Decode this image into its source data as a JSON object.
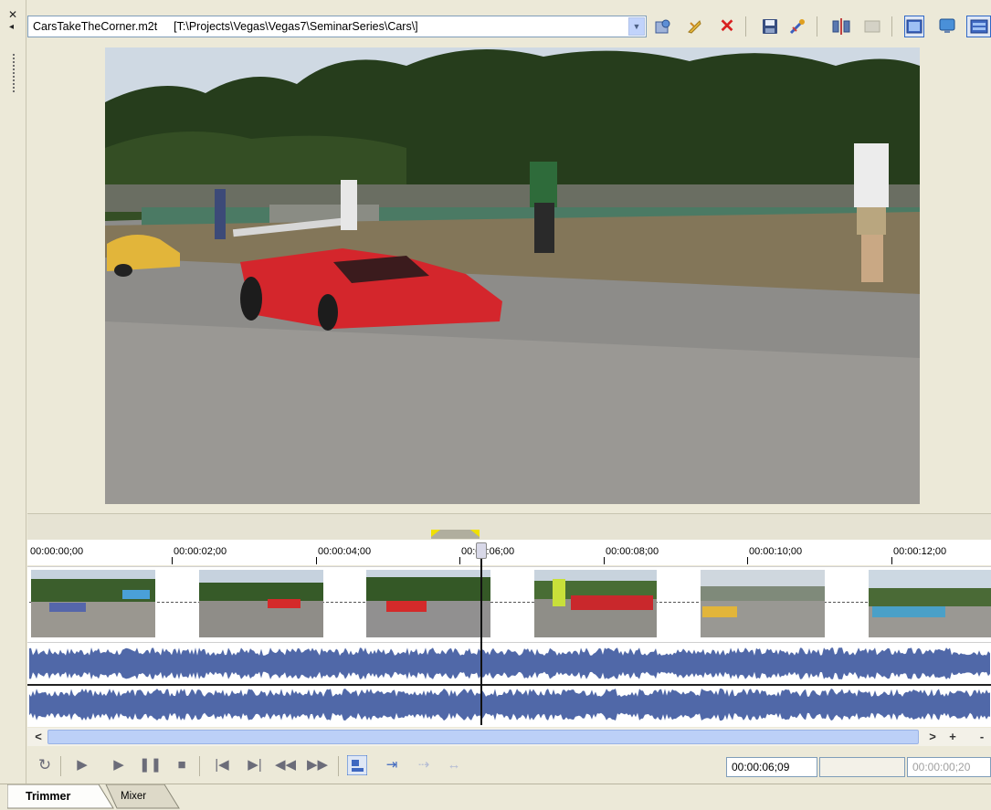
{
  "toolbar": {
    "file_name": "CarsTakeTheCorner.m2t",
    "file_path": "[T:\\Projects\\Vegas\\Vegas7\\SeminarSeries\\Cars\\]",
    "icons": [
      "open-in-explorer-icon",
      "edit-in-external-icon",
      "delete-icon",
      "save-icon",
      "settings-icon",
      "split-icon",
      "snapshot-icon",
      "video-preview-icon",
      "monitor-icon",
      "split-screen-icon"
    ]
  },
  "timeline": {
    "ruler": [
      "00:00:00;00",
      "00:00:02;00",
      "00:00:04;00",
      "00:00:06;00",
      "00:00:08;00",
      "00:00:10;00",
      "00:00:12;00"
    ]
  },
  "scrollbar": {
    "left_glyph": "<",
    "right_glyph": ">",
    "zoom_in_glyph": "+",
    "zoom_out_glyph": "-"
  },
  "transport": {
    "icons": [
      "loop-icon",
      "play-from-start-icon",
      "play-icon",
      "pause-icon",
      "stop-icon",
      "go-to-start-icon",
      "go-to-end-icon",
      "rewind-icon",
      "fast-forward-icon",
      "add-to-timeline-icon",
      "add-at-cursor-icon",
      "add-before-icon",
      "add-after-icon"
    ],
    "cursor_time": "00:00:06;09",
    "selection_length": "",
    "end_time": "00:00:00;20"
  },
  "tabs": [
    "Trimmer",
    "Mixer"
  ],
  "colors": {
    "panel_bg": "#ece9d8",
    "waveform": "#5068a8",
    "scroll_thumb": "#bcd0f7",
    "loop_marker": "#f0e000"
  }
}
